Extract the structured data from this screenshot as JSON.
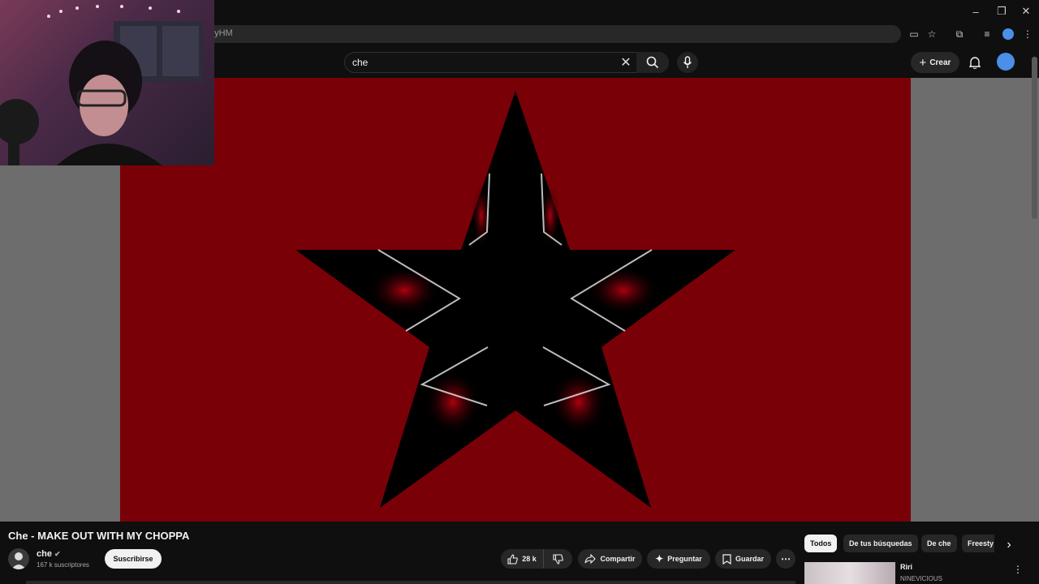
{
  "browser": {
    "url_fragment": "0yHM",
    "window_controls": {
      "minimize": "–",
      "restore": "❐",
      "close": "✕"
    }
  },
  "header": {
    "search_value": "che",
    "create_label": "Crear"
  },
  "video": {
    "title": "Che - MAKE OUT WITH MY CHOPPA",
    "background_color": "#7a0007",
    "star_color": "#000000"
  },
  "channel": {
    "name": "che",
    "subscribers": "167 k suscriptores",
    "subscribe_label": "Suscribirse"
  },
  "actions": {
    "likes": "28 k",
    "share_label": "Compartir",
    "ask_label": "Preguntar",
    "save_label": "Guardar"
  },
  "chips": [
    "Todos",
    "De tus búsquedas",
    "De che",
    "Freesty"
  ],
  "recommendation": {
    "title": "Riri",
    "channel": "NINEVICIOUS"
  },
  "colors": {
    "accent_blue": "#4a8fe8",
    "page_bg": "#0f0f0f"
  }
}
